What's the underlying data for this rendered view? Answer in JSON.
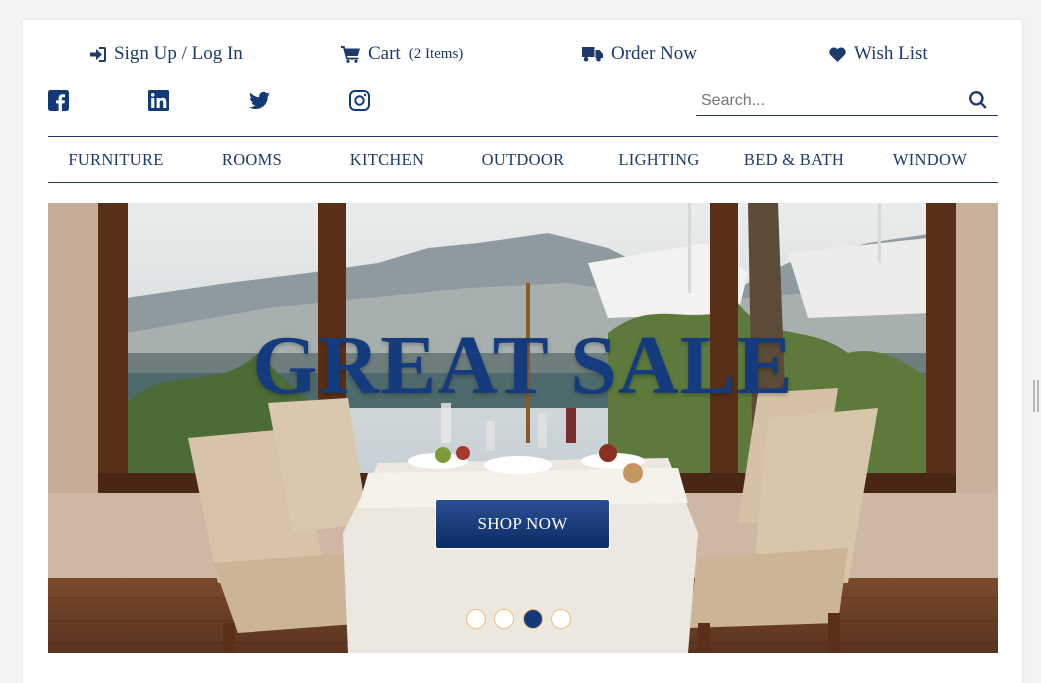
{
  "header": {
    "signin_label": "Sign Up / Log In",
    "cart_label": "Cart",
    "cart_count": "(2 Items)",
    "order_label": "Order Now",
    "wishlist_label": "Wish List"
  },
  "social": {
    "icons": [
      "facebook-icon",
      "linkedin-icon",
      "twitter-icon",
      "instagram-icon"
    ]
  },
  "search": {
    "placeholder": "Search...",
    "value": ""
  },
  "nav": {
    "items": [
      "FURNITURE",
      "ROOMS",
      "KITCHEN",
      "OUTDOOR",
      "LIGHTING",
      "BED & BATH",
      "WINDOW"
    ]
  },
  "hero": {
    "title": "GREAT SALE",
    "button_label": "SHOP NOW",
    "slide_count": 4,
    "active_slide": 3
  },
  "colors": {
    "brand": "#1d3a6b",
    "accent": "#143b7e",
    "background": "#f3f3f3"
  }
}
